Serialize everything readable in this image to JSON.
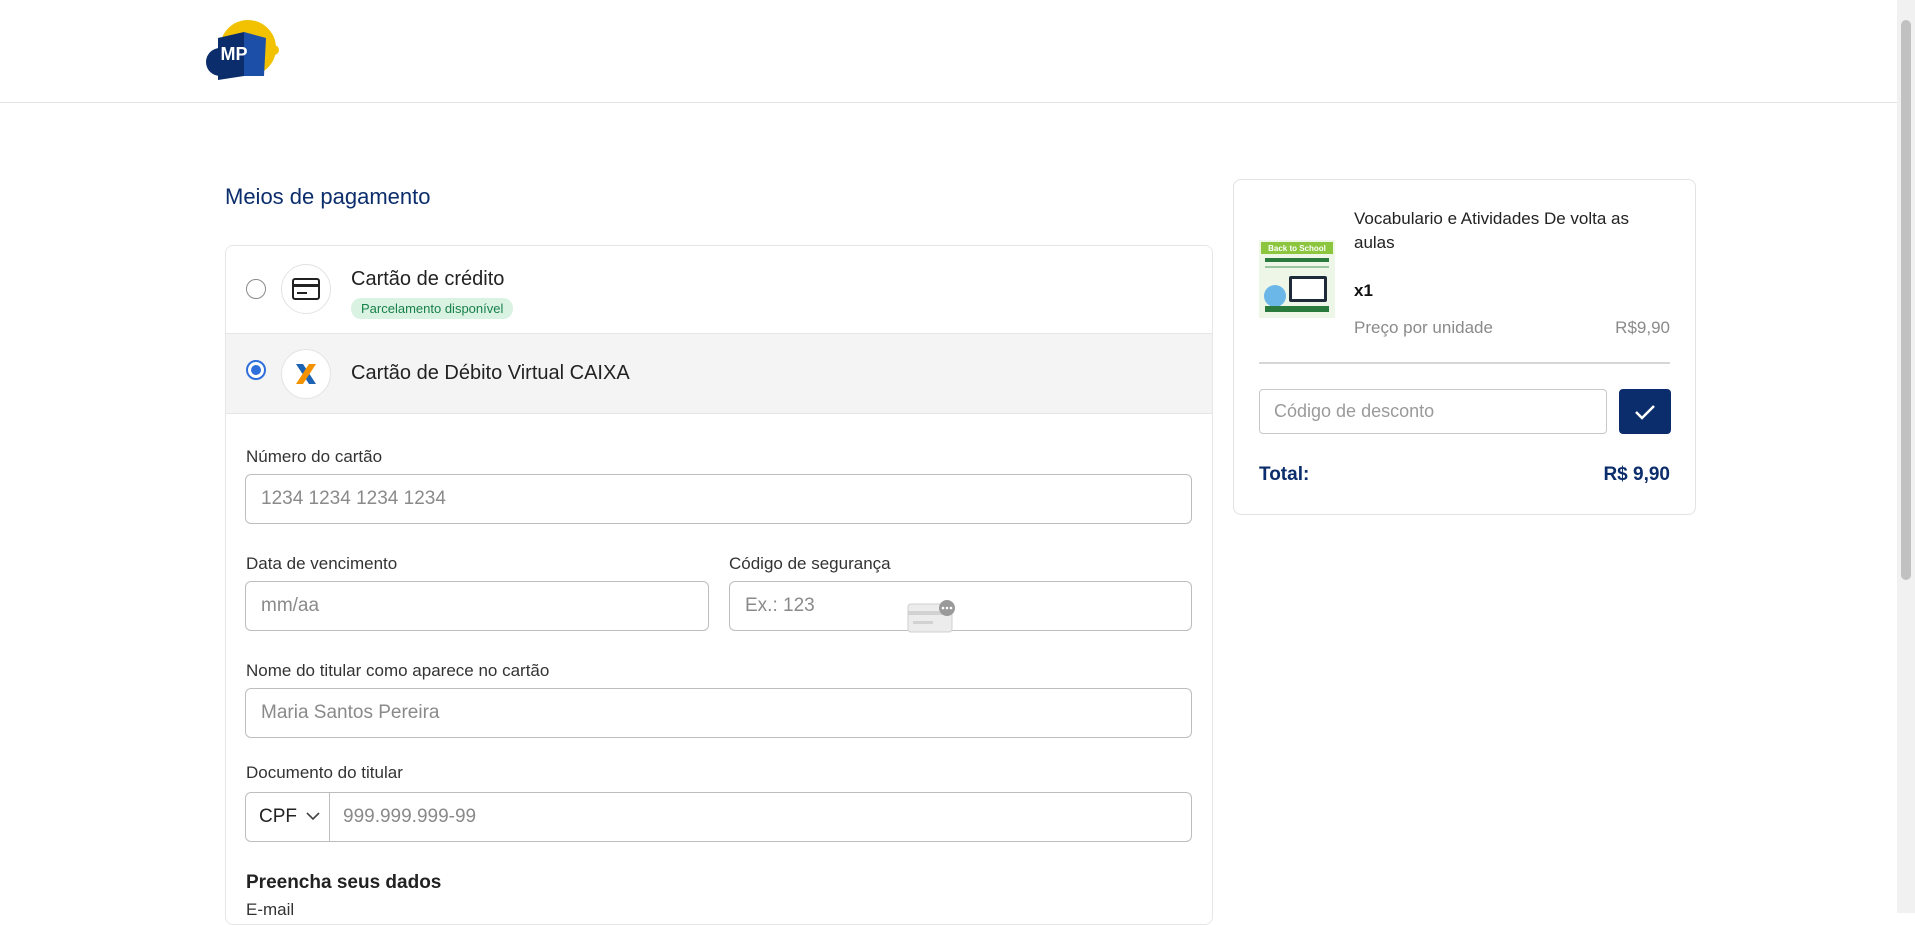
{
  "header": {
    "logo_text": "MP"
  },
  "payment": {
    "title": "Meios de pagamento",
    "options": [
      {
        "label": "Cartão de crédito",
        "badge": "Parcelamento disponível",
        "selected": false,
        "icon": "credit-card-icon"
      },
      {
        "label": "Cartão de Débito Virtual CAIXA",
        "selected": true,
        "icon": "caixa-logo-icon"
      }
    ],
    "form": {
      "card_number_label": "Número do cartão",
      "card_number_placeholder": "1234 1234 1234 1234",
      "expiry_label": "Data de vencimento",
      "expiry_placeholder": "mm/aa",
      "cvv_label": "Código de segurança",
      "cvv_placeholder": "Ex.: 123",
      "holder_label": "Nome do titular como aparece no cartão",
      "holder_placeholder": "Maria Santos Pereira",
      "document_label": "Documento do titular",
      "document_type": "CPF",
      "document_placeholder": "999.999.999-99",
      "fill_title": "Preencha seus dados",
      "email_label": "E-mail"
    }
  },
  "summary": {
    "product_name": "Vocabulario e Atividades De volta as aulas",
    "quantity": "x1",
    "unit_price_label": "Preço por unidade",
    "unit_price": "R$9,90",
    "discount_placeholder": "Código de desconto",
    "total_label": "Total:",
    "total_value": "R$ 9,90",
    "thumbnail_text": "Back to School"
  },
  "colors": {
    "brand_navy": "#0b2d6b",
    "radio_blue": "#2f6fdb",
    "badge_bg": "#d9f2e2",
    "badge_text": "#18804a"
  }
}
